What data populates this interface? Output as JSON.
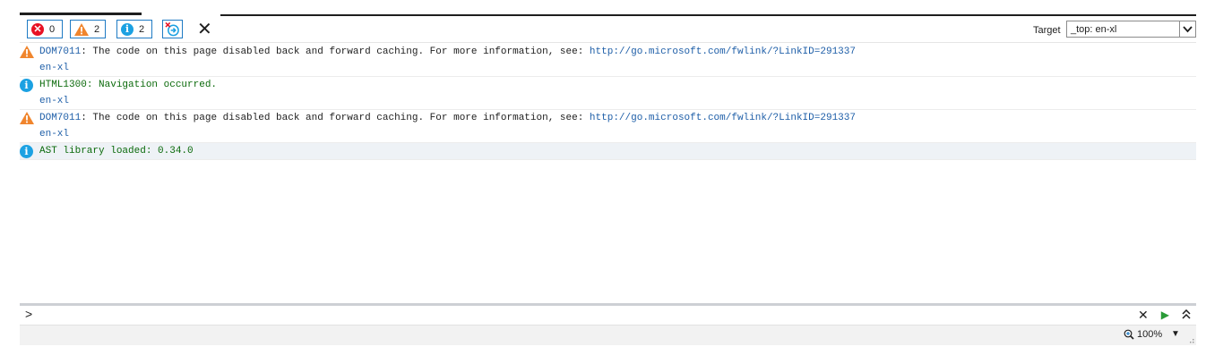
{
  "toolbar": {
    "errors_count": "0",
    "warnings_count": "2",
    "info_count": "2",
    "target_label": "Target",
    "target_value": "_top: en-xl"
  },
  "messages": [
    {
      "type": "warning",
      "code": "DOM7011",
      "text": ": The code on this page disabled back and forward caching. For more information, see: ",
      "link": "http://go.microsoft.com/fwlink/?LinkID=291337",
      "source": "en-xl"
    },
    {
      "type": "info",
      "code": "HTML1300",
      "text": ": Navigation occurred.",
      "link": "",
      "source": "en-xl"
    },
    {
      "type": "warning",
      "code": "DOM7011",
      "text": ": The code on this page disabled back and forward caching. For more information, see: ",
      "link": "http://go.microsoft.com/fwlink/?LinkID=291337",
      "source": "en-xl"
    },
    {
      "type": "info",
      "code": "",
      "text": "AST library loaded: 0.34.0",
      "link": "",
      "source": ""
    }
  ],
  "commandline": {
    "prompt": ">"
  },
  "statusbar": {
    "zoom": "100%"
  },
  "colors": {
    "error": "#e81123",
    "warning": "#f0852d",
    "info": "#1ba1e2",
    "accent": "#1f7bc4",
    "code_blue": "#1f5fa8",
    "success_green": "#0b6a0b"
  }
}
